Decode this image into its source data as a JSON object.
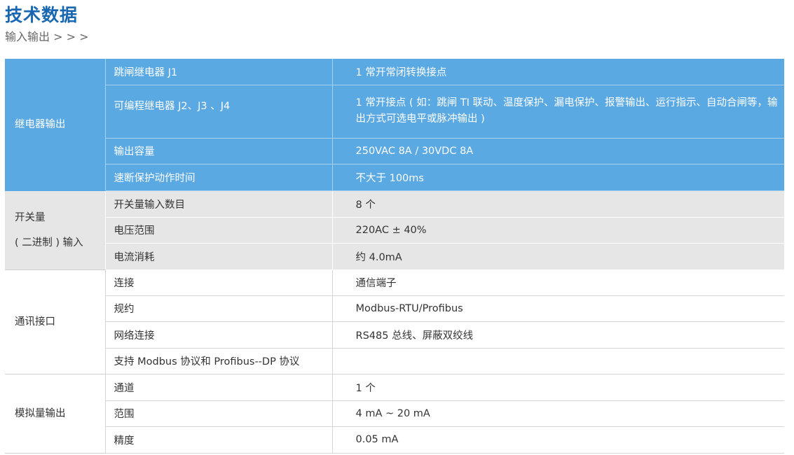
{
  "header": {
    "title": "技术数据",
    "subtitle": "输入输出 > > >"
  },
  "sections": [
    {
      "group": "继电器输出",
      "rows": [
        {
          "param": "跳闸继电器 J1",
          "value": "1 常开常闭转换接点"
        },
        {
          "param": "可编程继电器 J2、J3 、J4",
          "value": "1 常开接点 ( 如：跳闸 TI 联动、温度保护、漏电保护、报警输出、运行指示、自动合闸等，输出方式可选电平或脉冲输出 )"
        },
        {
          "param": "输出容量",
          "value": "250VAC  8A  /  30VDC   8A"
        },
        {
          "param": "速断保护动作时间",
          "value": "不大于 100ms"
        }
      ]
    },
    {
      "group": "开关量\n( 二进制 ) 输入",
      "group_line1": "开关量",
      "group_line2": "( 二进制 ) 输入",
      "rows": [
        {
          "param": "开关量输入数目",
          "value": "8 个"
        },
        {
          "param": "电压范围",
          "value": "220AC ± 40%"
        },
        {
          "param": "电流消耗",
          "value": "约 4.0mA"
        }
      ]
    },
    {
      "group": "通讯接口",
      "rows": [
        {
          "param": "连接",
          "value": "通信端子"
        },
        {
          "param": "规约",
          "value": "Modbus-RTU/Profibus"
        },
        {
          "param": "网络连接",
          "value": "RS485 总线、屏蔽双绞线"
        },
        {
          "param": "支持 Modbus 协议和 Profibus--DP 协议",
          "value": ""
        }
      ]
    },
    {
      "group": "模拟量输出",
      "rows": [
        {
          "param": "通道",
          "value": "1 个"
        },
        {
          "param": "范围",
          "value": "4 mA  ~  20 mA"
        },
        {
          "param": "精度",
          "value": "0.05 mA"
        }
      ]
    }
  ],
  "colors": {
    "title": "#1a67b1",
    "relay_section_bg": "#5aa9e3",
    "digital_input_section_bg": "#e6e6e6"
  }
}
